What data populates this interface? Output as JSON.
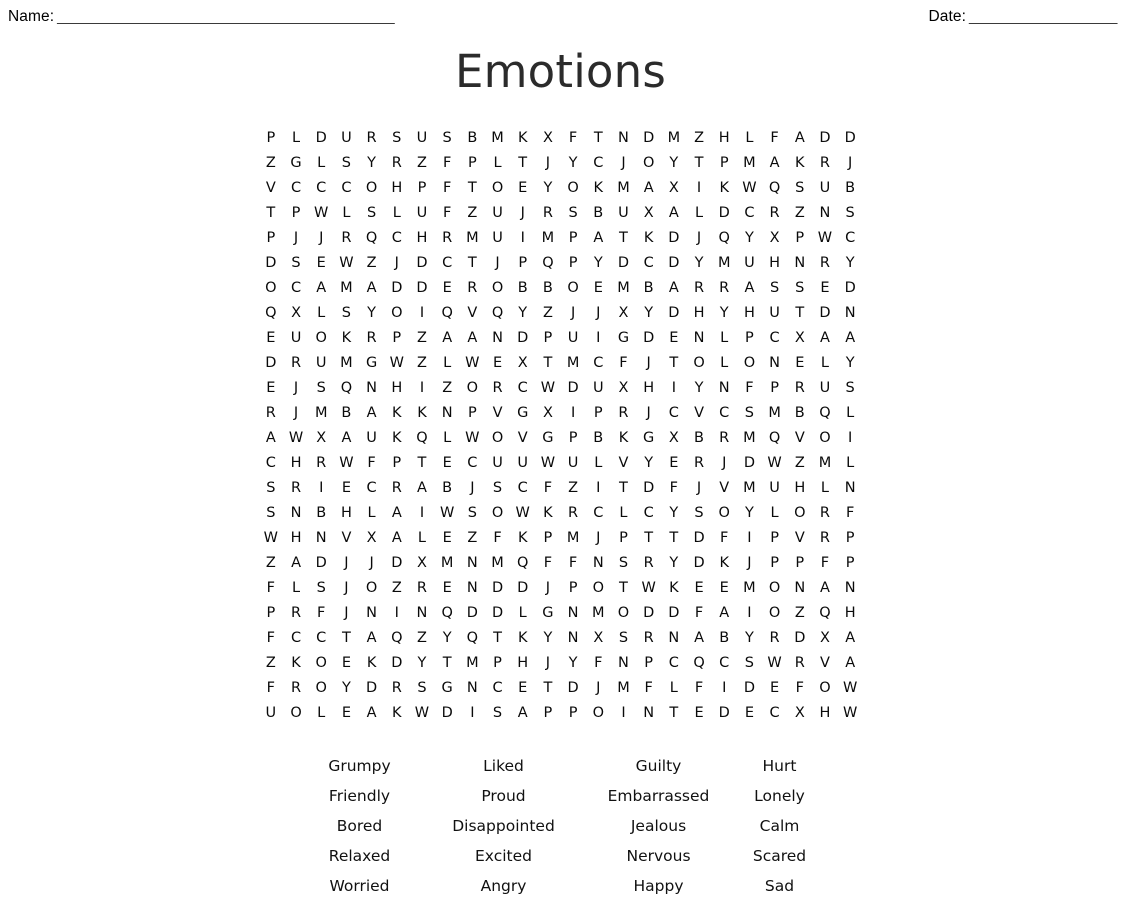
{
  "header": {
    "name_label": "Name:",
    "name_blank": "_________________________________________",
    "date_label": "Date:",
    "date_blank": "__________________"
  },
  "title": "Emotions",
  "grid": {
    "rows": 24,
    "cols": 24,
    "letters": [
      [
        "P",
        "L",
        "D",
        "U",
        "R",
        "S",
        "U",
        "S",
        "B",
        "M",
        "K",
        "X",
        "F",
        "T",
        "N",
        "D",
        "M",
        "Z",
        "H",
        "L",
        "F",
        "A",
        "D",
        "D"
      ],
      [
        "Z",
        "G",
        "L",
        "S",
        "Y",
        "R",
        "Z",
        "F",
        "P",
        "L",
        "T",
        "J",
        "Y",
        "C",
        "J",
        "O",
        "Y",
        "T",
        "P",
        "M",
        "A",
        "K",
        "R",
        "J"
      ],
      [
        "V",
        "C",
        "C",
        "C",
        "O",
        "H",
        "P",
        "F",
        "T",
        "O",
        "E",
        "Y",
        "O",
        "K",
        "M",
        "A",
        "X",
        "I",
        "K",
        "W",
        "Q",
        "S",
        "U",
        "B"
      ],
      [
        "T",
        "P",
        "W",
        "L",
        "S",
        "L",
        "U",
        "F",
        "Z",
        "U",
        "J",
        "R",
        "S",
        "B",
        "U",
        "X",
        "A",
        "L",
        "D",
        "C",
        "R",
        "Z",
        "N",
        "S"
      ],
      [
        "P",
        "J",
        "J",
        "R",
        "Q",
        "C",
        "H",
        "R",
        "M",
        "U",
        "I",
        "M",
        "P",
        "A",
        "T",
        "K",
        "D",
        "J",
        "Q",
        "Y",
        "X",
        "P",
        "W",
        "C"
      ],
      [
        "D",
        "S",
        "E",
        "W",
        "Z",
        "J",
        "D",
        "C",
        "T",
        "J",
        "P",
        "Q",
        "P",
        "Y",
        "D",
        "C",
        "D",
        "Y",
        "M",
        "U",
        "H",
        "N",
        "R",
        "Y"
      ],
      [
        "O",
        "C",
        "A",
        "M",
        "A",
        "D",
        "D",
        "E",
        "R",
        "O",
        "B",
        "B",
        "O",
        "E",
        "M",
        "B",
        "A",
        "R",
        "R",
        "A",
        "S",
        "S",
        "E",
        "D"
      ],
      [
        "Q",
        "X",
        "L",
        "S",
        "Y",
        "O",
        "I",
        "Q",
        "V",
        "Q",
        "Y",
        "Z",
        "J",
        "J",
        "X",
        "Y",
        "D",
        "H",
        "Y",
        "H",
        "U",
        "T",
        "D",
        "N"
      ],
      [
        "E",
        "U",
        "O",
        "K",
        "R",
        "P",
        "Z",
        "A",
        "A",
        "N",
        "D",
        "P",
        "U",
        "I",
        "G",
        "D",
        "E",
        "N",
        "L",
        "P",
        "C",
        "X",
        "A",
        "A"
      ],
      [
        "D",
        "R",
        "U",
        "M",
        "G",
        "W",
        "Z",
        "L",
        "W",
        "E",
        "X",
        "T",
        "M",
        "C",
        "F",
        "J",
        "T",
        "O",
        "L",
        "O",
        "N",
        "E",
        "L",
        "Y"
      ],
      [
        "E",
        "J",
        "S",
        "Q",
        "N",
        "H",
        "I",
        "Z",
        "O",
        "R",
        "C",
        "W",
        "D",
        "U",
        "X",
        "H",
        "I",
        "Y",
        "N",
        "F",
        "P",
        "R",
        "U",
        "S"
      ],
      [
        "R",
        "J",
        "M",
        "B",
        "A",
        "K",
        "K",
        "N",
        "P",
        "V",
        "G",
        "X",
        "I",
        "P",
        "R",
        "J",
        "C",
        "V",
        "C",
        "S",
        "M",
        "B",
        "Q",
        "L"
      ],
      [
        "A",
        "W",
        "X",
        "A",
        "U",
        "K",
        "Q",
        "L",
        "W",
        "O",
        "V",
        "G",
        "P",
        "B",
        "K",
        "G",
        "X",
        "B",
        "R",
        "M",
        "Q",
        "V",
        "O",
        "I"
      ],
      [
        "C",
        "H",
        "R",
        "W",
        "F",
        "P",
        "T",
        "E",
        "C",
        "U",
        "U",
        "W",
        "U",
        "L",
        "V",
        "Y",
        "E",
        "R",
        "J",
        "D",
        "W",
        "Z",
        "M",
        "L"
      ],
      [
        "S",
        "R",
        "I",
        "E",
        "C",
        "R",
        "A",
        "B",
        "J",
        "S",
        "C",
        "F",
        "Z",
        "I",
        "T",
        "D",
        "F",
        "J",
        "V",
        "M",
        "U",
        "H",
        "L",
        "N"
      ],
      [
        "S",
        "N",
        "B",
        "H",
        "L",
        "A",
        "I",
        "W",
        "S",
        "O",
        "W",
        "K",
        "R",
        "C",
        "L",
        "C",
        "Y",
        "S",
        "O",
        "Y",
        "L",
        "O",
        "R",
        "F"
      ],
      [
        "W",
        "H",
        "N",
        "V",
        "X",
        "A",
        "L",
        "E",
        "Z",
        "F",
        "K",
        "P",
        "M",
        "J",
        "P",
        "T",
        "T",
        "D",
        "F",
        "I",
        "P",
        "V",
        "R",
        "P"
      ],
      [
        "Z",
        "A",
        "D",
        "J",
        "J",
        "D",
        "X",
        "M",
        "N",
        "M",
        "Q",
        "F",
        "F",
        "N",
        "S",
        "R",
        "Y",
        "D",
        "K",
        "J",
        "P",
        "P",
        "F",
        "P"
      ],
      [
        "F",
        "L",
        "S",
        "J",
        "O",
        "Z",
        "R",
        "E",
        "N",
        "D",
        "D",
        "J",
        "P",
        "O",
        "T",
        "W",
        "K",
        "E",
        "E",
        "M",
        "O",
        "N",
        "A",
        "N"
      ],
      [
        "P",
        "R",
        "F",
        "J",
        "N",
        "I",
        "N",
        "Q",
        "D",
        "D",
        "L",
        "G",
        "N",
        "M",
        "O",
        "D",
        "D",
        "F",
        "A",
        "I",
        "O",
        "Z",
        "Q",
        "H"
      ],
      [
        "F",
        "C",
        "C",
        "T",
        "A",
        "Q",
        "Z",
        "Y",
        "Q",
        "T",
        "K",
        "Y",
        "N",
        "X",
        "S",
        "R",
        "N",
        "A",
        "B",
        "Y",
        "R",
        "D",
        "X",
        "A"
      ],
      [
        "Z",
        "K",
        "O",
        "E",
        "K",
        "D",
        "Y",
        "T",
        "M",
        "P",
        "H",
        "J",
        "Y",
        "F",
        "N",
        "P",
        "C",
        "Q",
        "C",
        "S",
        "W",
        "R",
        "V",
        "A"
      ],
      [
        "F",
        "R",
        "O",
        "Y",
        "D",
        "R",
        "S",
        "G",
        "N",
        "C",
        "E",
        "T",
        "D",
        "J",
        "M",
        "F",
        "L",
        "F",
        "I",
        "D",
        "E",
        "F",
        "O",
        "W"
      ],
      [
        "U",
        "O",
        "L",
        "E",
        "A",
        "K",
        "W",
        "D",
        "I",
        "S",
        "A",
        "P",
        "P",
        "O",
        "I",
        "N",
        "T",
        "E",
        "D",
        "E",
        "C",
        "X",
        "H",
        "W"
      ]
    ]
  },
  "word_list": {
    "columns": 4,
    "rows": [
      [
        "Grumpy",
        "Liked",
        "Guilty",
        "Hurt"
      ],
      [
        "Friendly",
        "Proud",
        "Embarrassed",
        "Lonely"
      ],
      [
        "Bored",
        "Disappointed",
        "Jealous",
        "Calm"
      ],
      [
        "Relaxed",
        "Excited",
        "Nervous",
        "Scared"
      ],
      [
        "Worried",
        "Angry",
        "Happy",
        "Sad"
      ]
    ]
  }
}
